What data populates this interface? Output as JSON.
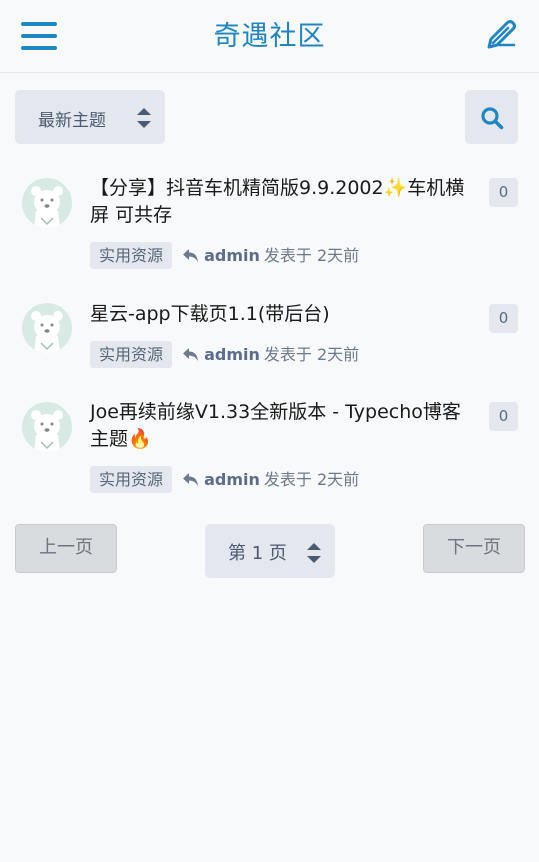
{
  "header": {
    "title": "奇遇社区"
  },
  "toolbar": {
    "sort_value": "最新主题"
  },
  "topics": [
    {
      "title": "【分享】抖音车机精简版9.9.2002✨车机横屏 可共存",
      "replies": "0",
      "tag": "实用资源",
      "author": "admin",
      "posted": "发表于 2天前"
    },
    {
      "title": "星云-app下载页1.1(带后台)",
      "replies": "0",
      "tag": "实用资源",
      "author": "admin",
      "posted": "发表于 2天前"
    },
    {
      "title": "Joe再续前缘V1.33全新版本 - Typecho博客主题🔥",
      "replies": "0",
      "tag": "实用资源",
      "author": "admin",
      "posted": "发表于 2天前"
    }
  ],
  "pagination": {
    "prev_label": "上一页",
    "page_value": "第 1 页",
    "next_label": "下一页"
  },
  "colors": {
    "accent": "#1f86c3",
    "chip_bg": "#e4e8ee",
    "avatar_bg": "#d7eae3"
  }
}
